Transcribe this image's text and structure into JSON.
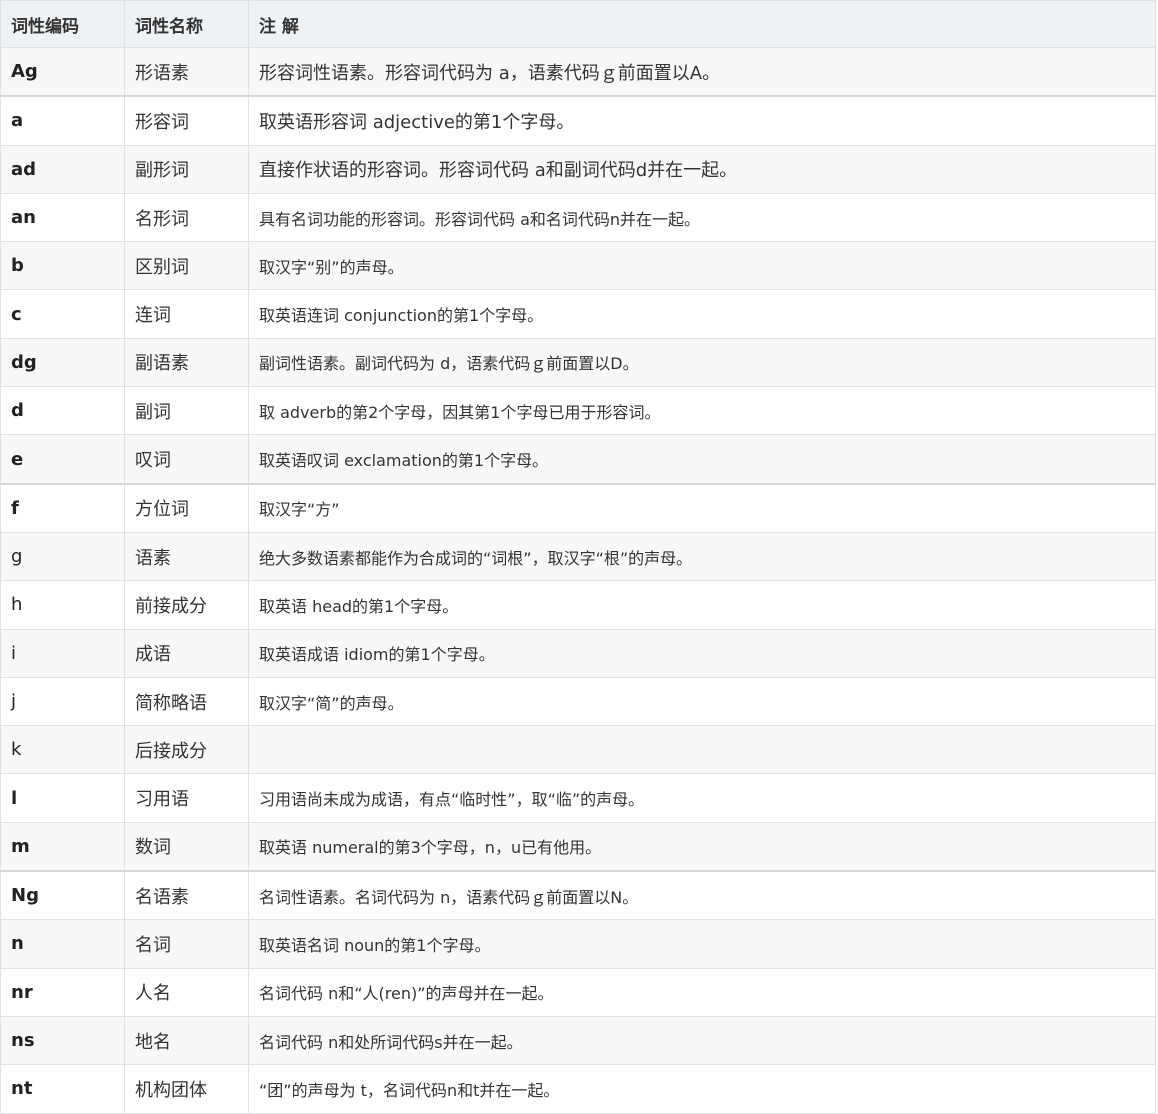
{
  "table": {
    "headers": [
      "词性编码",
      "词性名称",
      "注 解"
    ],
    "rows": [
      {
        "code": "Ag",
        "name": "形语素",
        "note": "形容词性语素。形容词代码为 a，语素代码ｇ前面置以A。"
      },
      {
        "code": "a",
        "name": "形容词",
        "note": "取英语形容词 adjective的第1个字母。"
      },
      {
        "code": "ad",
        "name": "副形词",
        "note": "直接作状语的形容词。形容词代码 a和副词代码d并在一起。"
      },
      {
        "code": "an",
        "name": "名形词",
        "note": "具有名词功能的形容词。形容词代码 a和名词代码n并在一起。"
      },
      {
        "code": "b",
        "name": "区别词",
        "note": "取汉字“别”的声母。"
      },
      {
        "code": "c",
        "name": "连词",
        "note": "取英语连词 conjunction的第1个字母。"
      },
      {
        "code": "dg",
        "name": "副语素",
        "note": "副词性语素。副词代码为 d，语素代码ｇ前面置以D。"
      },
      {
        "code": "d",
        "name": "副词",
        "note": "取 adverb的第2个字母，因其第1个字母已用于形容词。"
      },
      {
        "code": "e",
        "name": "叹词",
        "note": "取英语叹词 exclamation的第1个字母。"
      },
      {
        "code": "f",
        "name": "方位词",
        "note": "取汉字“方”"
      },
      {
        "code": "g",
        "name": "语素",
        "note": "绝大多数语素都能作为合成词的“词根”，取汉字“根”的声母。"
      },
      {
        "code": "h",
        "name": "前接成分",
        "note": "取英语 head的第1个字母。"
      },
      {
        "code": "i",
        "name": "成语",
        "note": "取英语成语 idiom的第1个字母。"
      },
      {
        "code": "j",
        "name": "简称略语",
        "note": "取汉字“简”的声母。"
      },
      {
        "code": "k",
        "name": "后接成分",
        "note": ""
      },
      {
        "code": "l",
        "name": "习用语",
        "note": "习用语尚未成为成语，有点“临时性”，取“临”的声母。"
      },
      {
        "code": "m",
        "name": "数词",
        "note": "取英语 numeral的第3个字母，n，u已有他用。"
      },
      {
        "code": "Ng",
        "name": "名语素",
        "note": "名词性语素。名词代码为 n，语素代码ｇ前面置以N。"
      },
      {
        "code": "n",
        "name": "名词",
        "note": "取英语名词 noun的第1个字母。"
      },
      {
        "code": "nr",
        "name": "人名",
        "note": "名词代码 n和“人(ren)”的声母并在一起。"
      },
      {
        "code": "ns",
        "name": "地名",
        "note": "名词代码 n和处所词代码s并在一起。"
      },
      {
        "code": "nt",
        "name": "机构团体",
        "note": "“团”的声母为 t，名词代码n和t并在一起。"
      }
    ]
  }
}
